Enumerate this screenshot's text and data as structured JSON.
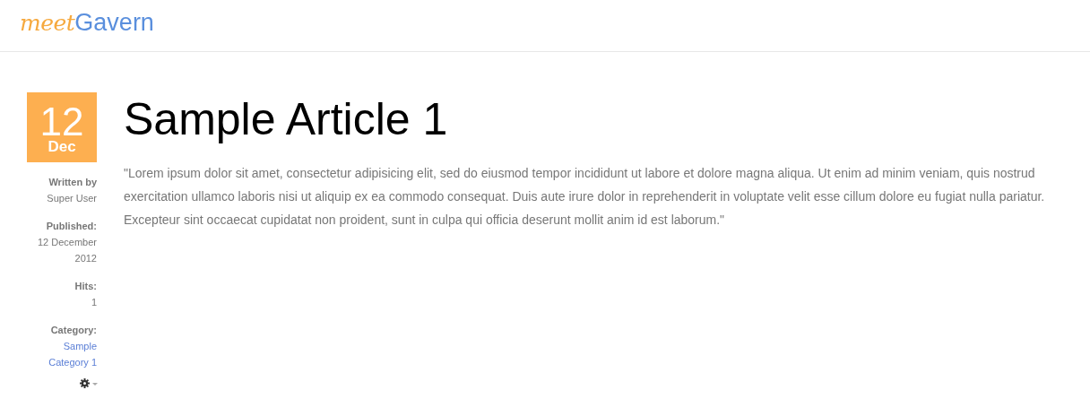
{
  "logo": {
    "first": "meet",
    "second": "Gavern"
  },
  "date": {
    "day": "12",
    "month": "Dec"
  },
  "meta": [
    {
      "label": "Written by",
      "value": "Super User",
      "kind": "text"
    },
    {
      "label": "Published:",
      "value": "12 December 2012",
      "kind": "text"
    },
    {
      "label": "Hits:",
      "value": "1",
      "kind": "text"
    },
    {
      "label": "Category:",
      "value": "Sample Category 1",
      "kind": "link"
    }
  ],
  "article": {
    "title": "Sample Article 1",
    "body": "\"Lorem ipsum dolor sit amet, consectetur adipisicing elit, sed do eiusmod tempor incididunt ut labore et dolore magna aliqua. Ut enim ad minim veniam, quis nostrud exercitation ullamco laboris nisi ut aliquip ex ea commodo consequat. Duis aute irure dolor in reprehenderit in voluptate velit esse cillum dolore eu fugiat nulla pariatur. Excepteur sint occaecat cupidatat non proident, sunt in culpa qui officia deserunt mollit anim id est laborum.\""
  }
}
